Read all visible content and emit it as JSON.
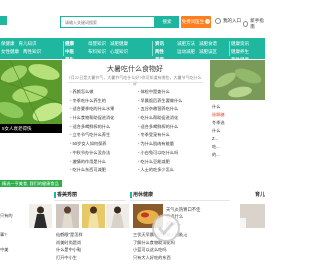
{
  "header": {
    "search_placeholder": "请输入关键词搜索",
    "search_button": "搜索",
    "consult_button": "免费问医生",
    "link_login": "我的入口",
    "link_guide": "新手指南"
  },
  "nav": {
    "block1": [
      "保健康",
      "育儿知识",
      "女性健康",
      "两性知识"
    ],
    "block2": [
      "健康",
      "中医",
      "养生",
      "保健",
      "减肥",
      "养生"
    ],
    "block3": [
      "母婴知识",
      "减肥健康",
      "布料知识",
      "心理知识"
    ],
    "block4": [
      "资讯",
      "两性",
      "美容",
      "育儿"
    ],
    "block5": [
      "减肥方法",
      "减肥食谱",
      "运动减肥",
      "减肥误区"
    ],
    "block6": [
      "健康资讯",
      "健康养生",
      "两性健康",
      "育儿知识"
    ]
  },
  "left_caption": "5女人衰老得快",
  "article": {
    "title": "大暑吃什么食物好",
    "subtitle": "7月22日是大暑节气，大暑节气吃什么好?你可知道有哪些，大暑节气吃什么好",
    "col1": [
      "养颜怎么做",
      "冬季吃什么养生的",
      "适合夏季吃的什么水果",
      "什么食物帮助促进消化",
      "适合多喝鲜榨的什么",
      "立冬节气吃什么养生",
      "50岁女人如何保养",
      "中秋节办什么没办法",
      "激情的作用是什么",
      "吃什么东西可减肥"
    ],
    "col2": [
      "体检中是查什么",
      "早晨饭后养生要做什么",
      "五谷杂粮营养吃什么",
      "吃什么帮助促进消化",
      "适合多喝鲜榨的什么",
      "冬季受宠有什么",
      "为什么肌肉有能量",
      "小白兔可以吃什么吗",
      "吃什么豆能减肥",
      "人士的吃多少怎么"
    ]
  },
  "right_list": [
    "什么",
    "秘解糖",
    "冬季选",
    "什么",
    "Z...",
    "吃...",
    "的..."
  ],
  "green_bar": "精选一亨美食, 我们的健康食品",
  "sections": {
    "fashion_title": "香美秀丽",
    "health_title": "用休健康",
    "right_title": "育儿"
  },
  "lower_left": [
    "只有的",
    "事?",
    "中美"
  ],
  "fashion_list": [
    "仙鹤眼\"是怎样",
    "尚美时尚是尚",
    "什么是中小鞋",
    "打开中小生"
  ],
  "health_text": [
    "天气炎热胃口不佳",
    "吃点什么",
    "好?大..."
  ],
  "health_list": [
    "三伏天早晨吃点好处人时能活",
    "了解什么食物助消化吗",
    "小蓝可以这么吃吗",
    "只有大人好吃的东西"
  ],
  "colors": {
    "brand": "#1fb7a0",
    "consult": "#ff7f1e",
    "green_bar": "#2db04b"
  }
}
